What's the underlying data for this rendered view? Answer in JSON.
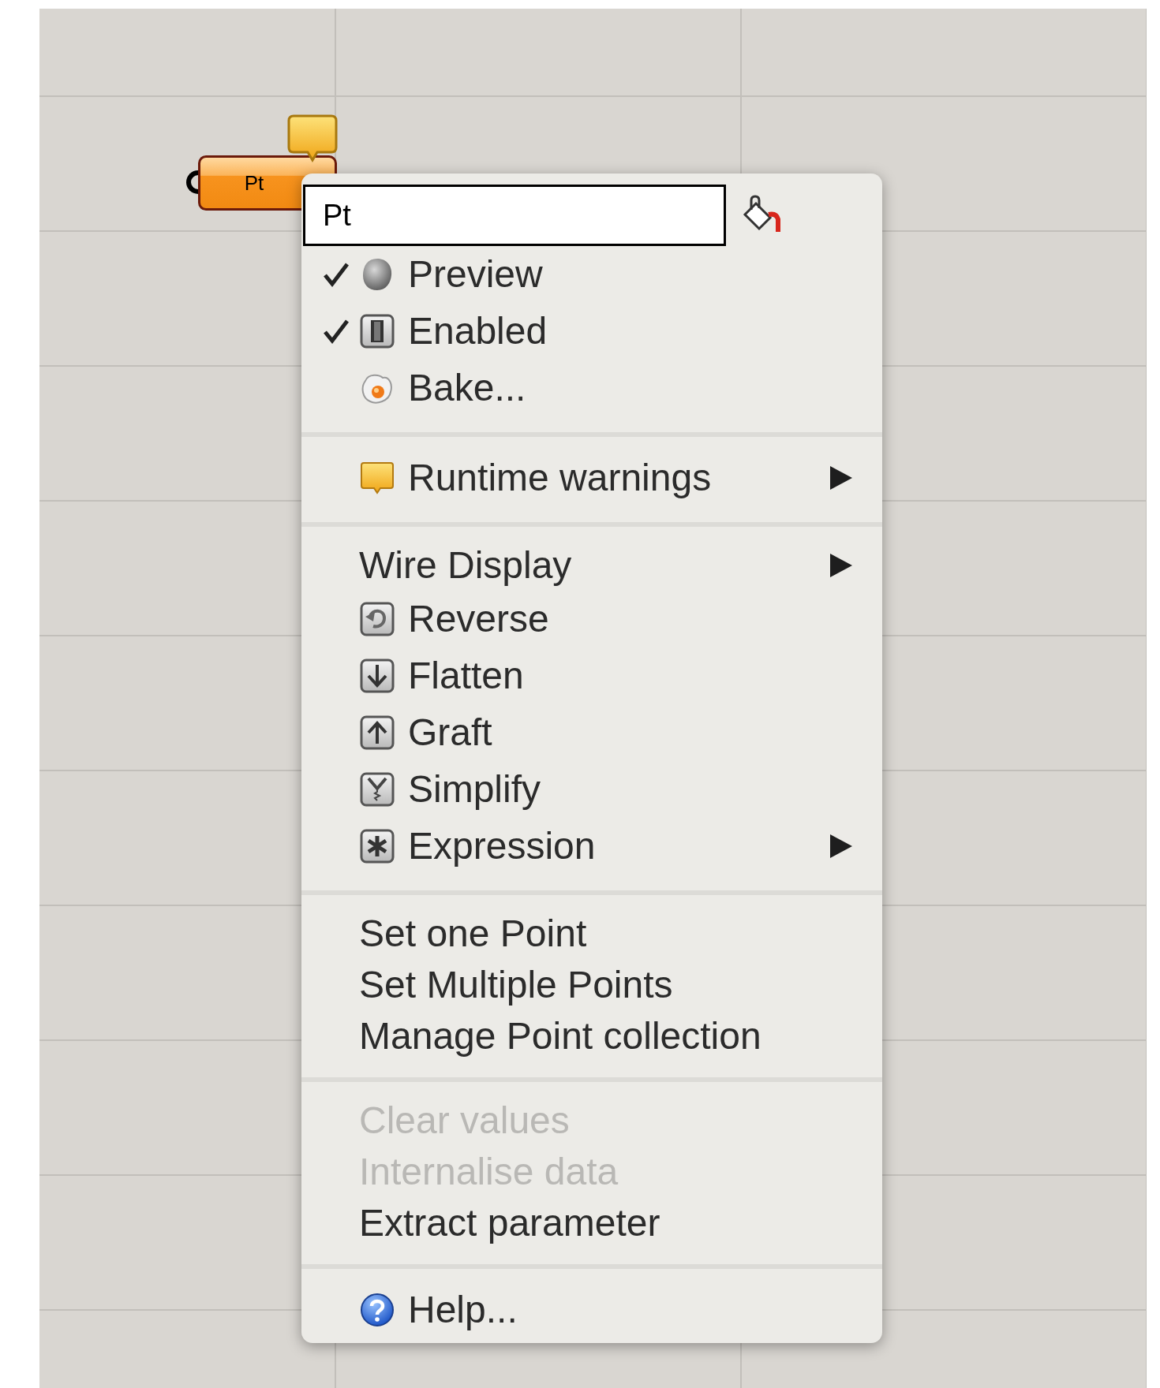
{
  "canvas": {
    "node": {
      "label": "Pt"
    }
  },
  "menu": {
    "name_field": {
      "value": "Pt"
    },
    "sections": [
      {
        "items": [
          {
            "label": "Preview",
            "kind": "preview",
            "checked": true
          },
          {
            "label": "Enabled",
            "kind": "enabled",
            "checked": true
          },
          {
            "label": "Bake...",
            "kind": "bake",
            "checked": false
          }
        ]
      },
      {
        "items": [
          {
            "label": "Runtime warnings",
            "kind": "warning",
            "submenu": true
          }
        ]
      },
      {
        "items": [
          {
            "label": "Wire Display",
            "kind": "plain",
            "submenu": true
          },
          {
            "label": "Reverse",
            "kind": "reverse",
            "submenu": false
          },
          {
            "label": "Flatten",
            "kind": "flatten",
            "submenu": false
          },
          {
            "label": "Graft",
            "kind": "graft",
            "submenu": false
          },
          {
            "label": "Simplify",
            "kind": "simplify",
            "submenu": false
          },
          {
            "label": "Expression",
            "kind": "expression",
            "submenu": true
          }
        ]
      },
      {
        "items": [
          {
            "label": "Set one Point",
            "kind": "plain"
          },
          {
            "label": "Set Multiple Points",
            "kind": "plain"
          },
          {
            "label": "Manage Point collection",
            "kind": "plain"
          }
        ]
      },
      {
        "items": [
          {
            "label": "Clear values",
            "kind": "plain",
            "disabled": true
          },
          {
            "label": "Internalise data",
            "kind": "plain",
            "disabled": true
          },
          {
            "label": "Extract parameter",
            "kind": "plain",
            "disabled": false
          }
        ]
      },
      {
        "items": [
          {
            "label": "Help...",
            "kind": "help"
          }
        ]
      }
    ]
  }
}
